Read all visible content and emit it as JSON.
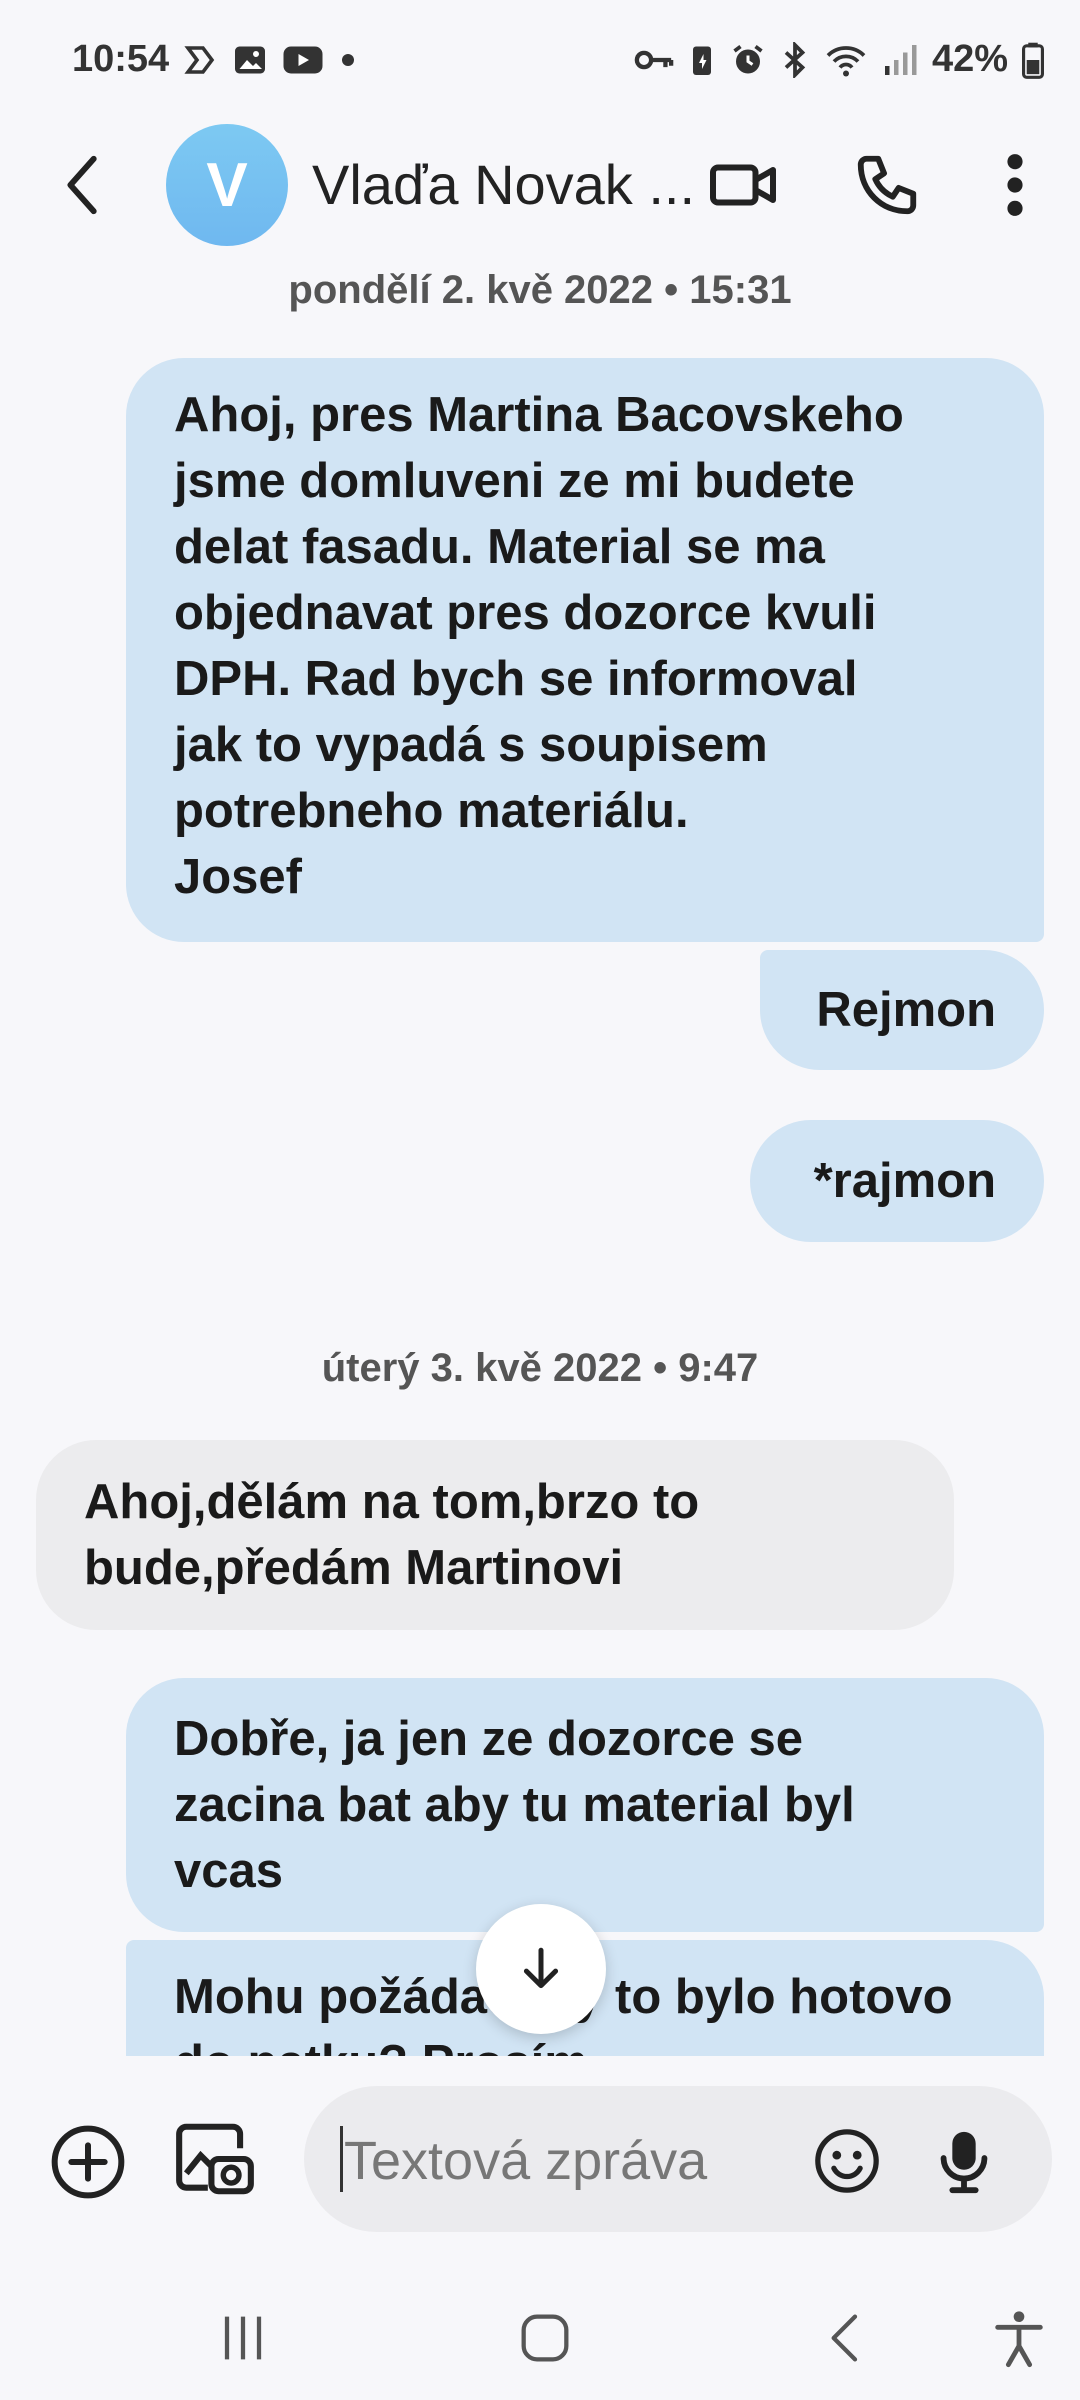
{
  "status_bar": {
    "time": "10:54",
    "battery": "42%",
    "left_icons": [
      "threads-icon",
      "gallery-icon",
      "youtube-icon",
      "dot-icon"
    ],
    "right_icons": [
      "key-icon",
      "battery-saver-icon",
      "alarm-icon",
      "bluetooth-icon",
      "wifi-icon",
      "signal-icon",
      "battery-icon"
    ]
  },
  "header": {
    "avatar_initial": "V",
    "contact_name": "Vlaďa Novak ...",
    "avatar_color": "#74c0f1"
  },
  "messages": {
    "date_1": "pondělí 2. kvě 2022 • 15:31",
    "msg_1_lines": [
      "Ahoj, pres Martina Bacovskeho",
      "jsme domluveni ze mi budete",
      "delat fasadu. Material se ma",
      "objednavat pres dozorce kvuli",
      "DPH. Rad bych se informoval",
      "jak to vypadá s soupisem",
      "potrebneho materiálu.",
      "Josef"
    ],
    "msg_2": "Rejmon",
    "msg_3": "*rajmon",
    "date_2": "úterý 3. kvě 2022 • 9:47",
    "msg_4_lines": [
      "Ahoj,dělám na tom,brzo to",
      "bude,předám Martinovi"
    ],
    "msg_5_lines": [
      "Dobře,  ja jen ze dozorce se",
      "zacina bat aby tu material byl",
      "vcas"
    ],
    "msg_6_lines": [
      "Mohu požádat aby to bylo hotovo",
      "do patku? Prosím"
    ]
  },
  "composer": {
    "placeholder": "Textová zpráva"
  },
  "colors": {
    "outgoing_bubble": "#d1e4f4",
    "incoming_bubble": "#ececee",
    "background": "#f7f7fa"
  }
}
